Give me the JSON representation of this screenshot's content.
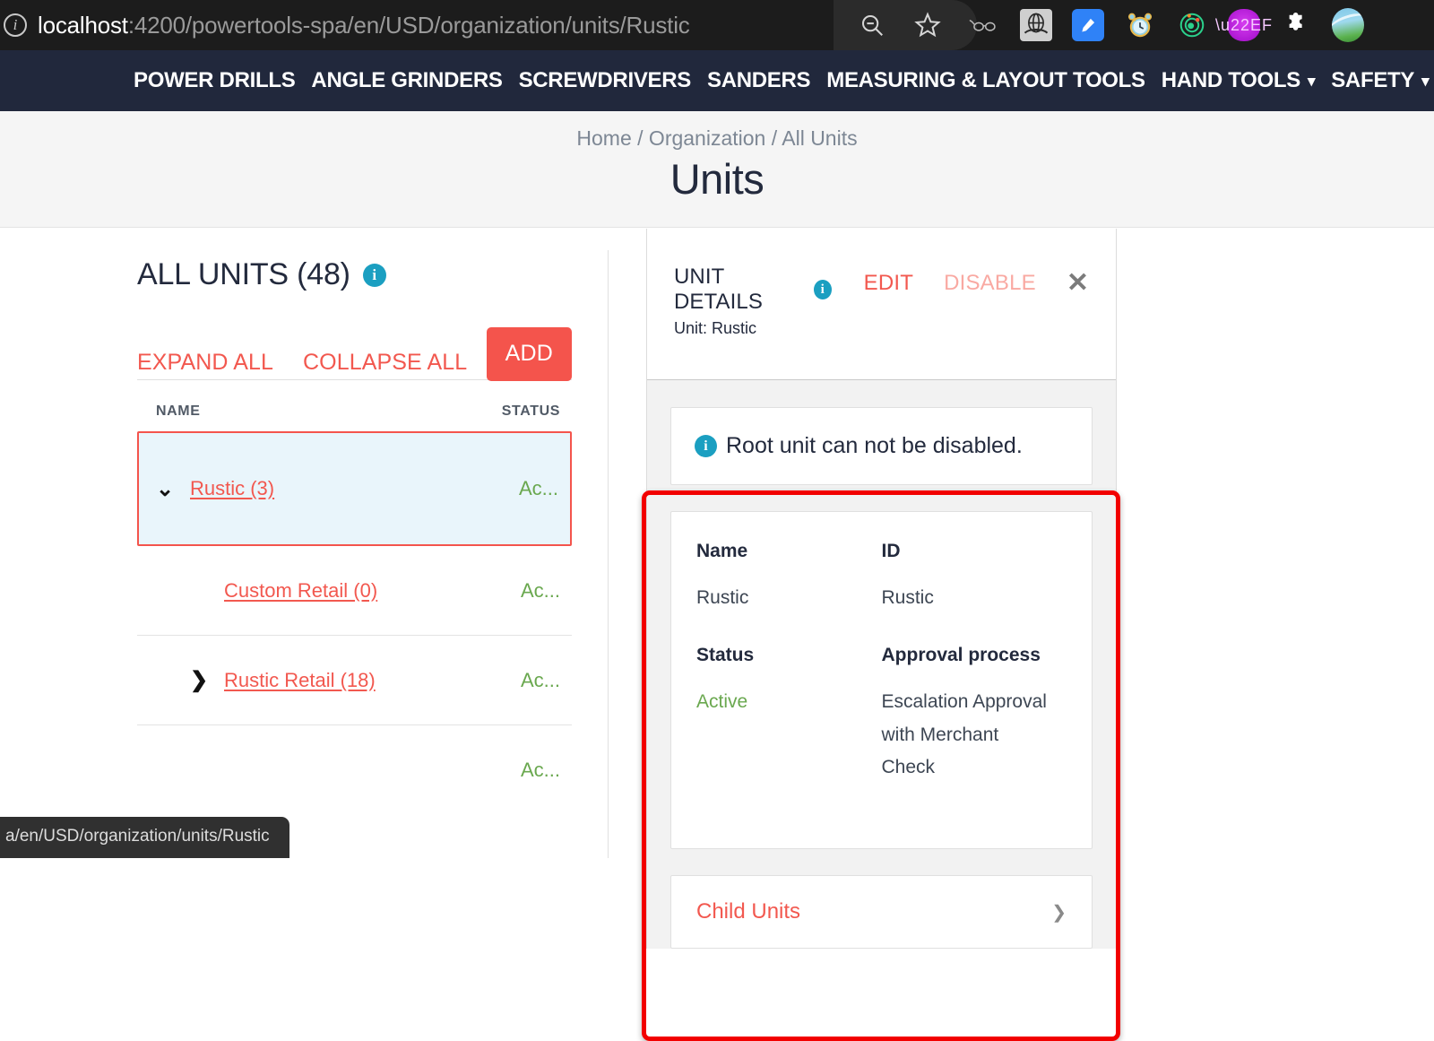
{
  "browser": {
    "url_host": "localhost",
    "url_path": ":4200/powertools-spa/en/USD/organization/units/Rustic",
    "info_icon": "site-info-icon",
    "actions": [
      {
        "name": "zoom-out-icon",
        "glyph": "⊖"
      },
      {
        "name": "bookmark-star-icon",
        "glyph": "☆"
      }
    ],
    "extensions": [
      {
        "name": "reader-glasses-icon",
        "glyph": "ɔ─ɔ"
      },
      {
        "name": "globe-grid-icon",
        "glyph": "☷"
      },
      {
        "name": "pen-edit-icon",
        "glyph": "✒"
      },
      {
        "name": "alarm-clock-icon",
        "glyph": "⏰"
      },
      {
        "name": "target-orbit-icon",
        "glyph": "◎"
      },
      {
        "name": "purple-chat-icon",
        "glyph": "⋯"
      },
      {
        "name": "puzzle-extension-icon",
        "glyph": "❖"
      },
      {
        "name": "profile-avatar-icon",
        "glyph": ""
      }
    ],
    "status_bar_url": "a/en/USD/organization/units/Rustic"
  },
  "site_nav": {
    "items": [
      {
        "label": "POWER DRILLS",
        "has_caret": false
      },
      {
        "label": "ANGLE GRINDERS",
        "has_caret": false
      },
      {
        "label": "SCREWDRIVERS",
        "has_caret": false
      },
      {
        "label": "SANDERS",
        "has_caret": false
      },
      {
        "label": "MEASURING & LAYOUT TOOLS",
        "has_caret": false
      },
      {
        "label": "HAND TOOLS",
        "has_caret": true
      },
      {
        "label": "SAFETY",
        "has_caret": true
      }
    ]
  },
  "page": {
    "breadcrumb": "Home / Organization / All Units",
    "title": "Units"
  },
  "units_list": {
    "heading": "ALL UNITS (48)",
    "info_icon_label": "i",
    "expand_all": "EXPAND ALL",
    "collapse_all": "COLLAPSE ALL",
    "add": "ADD",
    "col_name": "NAME",
    "col_status": "STATUS",
    "rows": [
      {
        "name": "Rustic (3)",
        "status": "Ac...",
        "chevron": "⌄",
        "expanded": true,
        "selected": true,
        "indent": 0
      },
      {
        "name": "Custom Retail (0)",
        "status": "Ac...",
        "chevron": "",
        "expanded": false,
        "selected": false,
        "indent": 1
      },
      {
        "name": "Rustic Retail (18)",
        "status": "Ac...",
        "chevron": "❯",
        "expanded": false,
        "selected": false,
        "indent": 1
      },
      {
        "name": "",
        "status": "Ac...",
        "chevron": "",
        "expanded": false,
        "selected": false,
        "indent": 1
      }
    ]
  },
  "unit_details": {
    "title": "UNIT DETAILS",
    "info_icon_label": "i",
    "subtitle": "Unit: Rustic",
    "edit": "EDIT",
    "disable": "DISABLE",
    "close": "✕",
    "alert": {
      "icon_label": "i",
      "text": "Root unit can not be disabled."
    },
    "fields": {
      "name_label": "Name",
      "name_value": "Rustic",
      "id_label": "ID",
      "id_value": "Rustic",
      "status_label": "Status",
      "status_value": "Active",
      "approval_label": "Approval process",
      "approval_value": "Escalation Approval with Merchant Check"
    },
    "child_units": {
      "title": "Child Units",
      "chevron": "❯"
    }
  },
  "colors": {
    "accent_red": "#f4544c",
    "link_red": "#f2584f",
    "highlight_red": "#f20000",
    "info_teal": "#1b9fc1",
    "status_green": "#6aa84f",
    "nav_dark": "#21283c",
    "chrome_dark": "#1c1c1c"
  }
}
